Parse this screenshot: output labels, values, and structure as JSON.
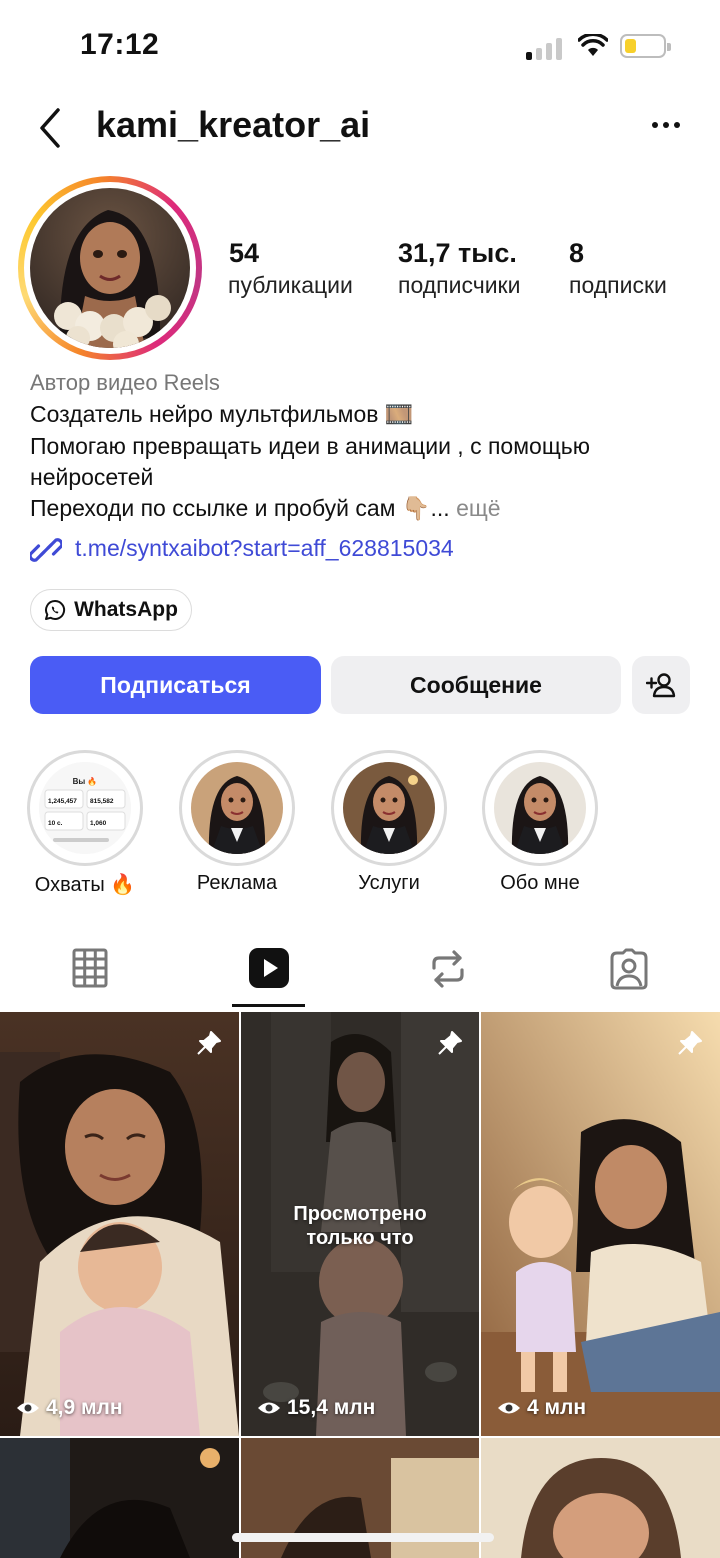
{
  "status_bar": {
    "time": "17:12"
  },
  "header": {
    "username": "kami_kreator_ai"
  },
  "stats": [
    {
      "value": "54",
      "label": "публикации"
    },
    {
      "value": "31,7 тыс.",
      "label": "подписчики"
    },
    {
      "value": "8",
      "label": "подписки"
    }
  ],
  "bio": {
    "category": "Автор видео Reels",
    "line1": "Создатель нейро мультфильмов 🎞️",
    "line2": "Помогаю превращать идеи в анимации , с помощью",
    "line3": "нейросетей",
    "line4": "Переходи по ссылке и пробуй сам 👇🏼...",
    "more": "ещё",
    "link": "t.me/syntxaibot?start=aff_628815034"
  },
  "whatsapp": {
    "label": "WhatsApp"
  },
  "actions": {
    "follow": "Подписаться",
    "message": "Сообщение"
  },
  "highlights": [
    {
      "label": "Охваты 🔥"
    },
    {
      "label": "Реклама"
    },
    {
      "label": "Услуги"
    },
    {
      "label": "Обо мне"
    }
  ],
  "highlight_thumb_text": {
    "title": "Вы 🔥",
    "n1": "1,245,457",
    "n2": "815,582",
    "n3": "10 с.",
    "n4": "1,060"
  },
  "grid": [
    {
      "views": "4,9 млн",
      "pinned": true
    },
    {
      "views": "15,4 млн",
      "pinned": true,
      "overlay": "Просмотрено\nтолько что"
    },
    {
      "views": "4 млн",
      "pinned": true
    }
  ],
  "colors": {
    "accent": "#4a5cf5",
    "link": "#3f4ad6"
  }
}
